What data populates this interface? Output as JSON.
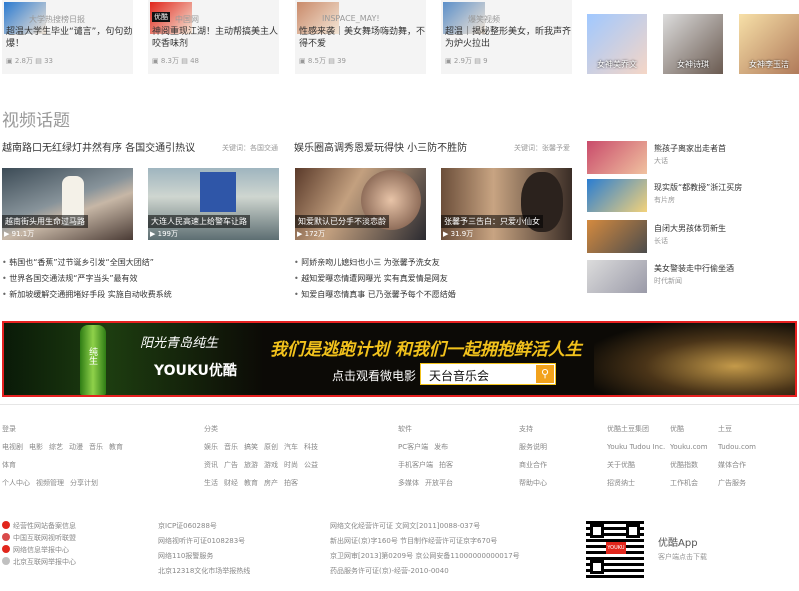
{
  "top_cards": [
    {
      "source": "大学热搜榜日报",
      "title": "超温大学生毕业“谴言”，句句劲爆！",
      "views": "2.8万",
      "comments": "33",
      "badge": "",
      "thumb_color": "#2a7ad0"
    },
    {
      "source": "中国网",
      "title": "神阅重现江湖！主动帮搞美主人咬香味剂",
      "views": "8.3万",
      "comments": "48",
      "badge": "优酷",
      "thumb_color": "#e1261c"
    },
    {
      "source": "INSPACE_MAY!",
      "title": "性感来袭｜美女舞场嗨劲舞，不得不爱",
      "views": "8.5万",
      "comments": "39",
      "badge": "",
      "thumb_color": "#c98a6a"
    },
    {
      "source": "爆笑视频",
      "title": "超温｜揭秘整形美女，昕我声齐为炉火拉出",
      "views": "2.9万",
      "comments": "9",
      "badge": "",
      "thumb_color": "#5b8fc9"
    }
  ],
  "avatars": [
    {
      "label": "女神美乔文"
    },
    {
      "label": "女神诗琪"
    },
    {
      "label": "女神李玉洁"
    }
  ],
  "video_section": {
    "title": "视频话题",
    "topics": [
      {
        "headline": "越南路口无红绿灯井然有序 各国交通引热议",
        "keywords": "关键词：各国交通"
      },
      {
        "headline": "娱乐圈高调秀恩爱玩得快 小三防不胜防",
        "keywords": "关键词：张馨予爱"
      }
    ],
    "videos": [
      {
        "caption": "越南街头用生命过马路",
        "count": "91.1万"
      },
      {
        "caption": "大连人民高速上给警车让路",
        "count": "199万"
      },
      {
        "caption": "知爱默认已分手不淡恋龄",
        "count": "172万"
      },
      {
        "caption": "张馨予三告白：只爱小仙女",
        "count": "31.9万"
      }
    ],
    "bullets_left": [
      "韩国也“香蕉”过节诞乡引发“全国大团结”",
      "世界各国交通法规“严字当头”最有效",
      "新加坡缓解交通拥堵好手段 实施自动收费系统"
    ],
    "bullets_right": [
      "阿娇亲吻儿媳妇也小三 为张馨予洗女友",
      "越知爱曝恋情遭网曝光 实有真爱情是网友",
      "知爱自曝恋情真事 已乃张馨予每个不愿结婚"
    ],
    "side_items": [
      {
        "title": "熊孩子离家出走者首",
        "sub": "大话"
      },
      {
        "title": "现实版“都教授”浙江买房",
        "sub": "有片房"
      },
      {
        "title": "自闭大男孩体罚新生",
        "sub": "长话"
      },
      {
        "title": "美女警装走中行偷坐酒",
        "sub": "时代新闻"
      }
    ]
  },
  "banner": {
    "logo_text": "阳光青岛纯生",
    "youku": "YOUKU优酷",
    "slogan": "我们是逃跑计划 和我们一起拥抱鲜活人生",
    "cta": "点击观看微电影",
    "search_text": "天台音乐会",
    "bottle_label": "纯生"
  },
  "footer": {
    "col1": {
      "head": "登录",
      "rows": [
        [
          "电视剧",
          "电影",
          "综艺",
          "动漫",
          "音乐",
          "教育"
        ],
        [
          "体育"
        ],
        [
          "个人中心",
          "视频管理",
          "分享计划"
        ]
      ]
    },
    "col2": {
      "head": "分类",
      "rows": [
        [
          "娱乐",
          "音乐",
          "搞笑",
          "原创",
          "汽车",
          "科技"
        ],
        [
          "资讯",
          "广告",
          "旅游",
          "游戏",
          "时尚",
          "公益"
        ],
        [
          "生活",
          "财经",
          "教育",
          "房产",
          "拍客"
        ]
      ]
    },
    "col3": {
      "head": "软件",
      "rows": [
        [
          "PC客户端",
          "发布"
        ],
        [
          "手机客户端",
          "拍客"
        ],
        [
          "多媒体",
          "开放平台"
        ]
      ]
    },
    "col4": {
      "head": "支持",
      "rows": [
        [
          "服务说明"
        ],
        [
          "商业合作"
        ],
        [
          "帮助中心"
        ]
      ]
    },
    "col5": {
      "head": "优酷土豆集团",
      "rows": [
        [
          "Youku Tudou Inc."
        ],
        [
          "关于优酷"
        ],
        [
          "招贤纳士"
        ]
      ]
    },
    "col6": {
      "head": "优酷",
      "rows": [
        [
          "Youku.com"
        ],
        [
          "优酷指数"
        ],
        [
          "工作机会"
        ]
      ]
    },
    "col7": {
      "head": "土豆",
      "rows": [
        [
          "Tudou.com"
        ],
        [
          "媒体合作"
        ],
        [
          "广告服务"
        ]
      ]
    },
    "badges": [
      "经营性网站备案信息",
      "中国互联网视听联盟",
      "网络信息举报中心",
      "北京互联网举报中心"
    ],
    "legal_1": [
      "京ICP证060288号",
      "网络视听许可证0108283号",
      "网络110报警服务",
      "北京12318文化市场举报热线"
    ],
    "legal_2": [
      "网络文化经营许可证 文网文[2011]0088-037号",
      "新出网证(京)字160号 节目制作经营许可证京字670号",
      "京卫网审[2013]第0209号 京公网安备11000000000017号",
      "药品服务许可证(京)-经营-2010-0040"
    ],
    "app": {
      "title": "优酷App",
      "sub": "客户端点击下载"
    }
  }
}
